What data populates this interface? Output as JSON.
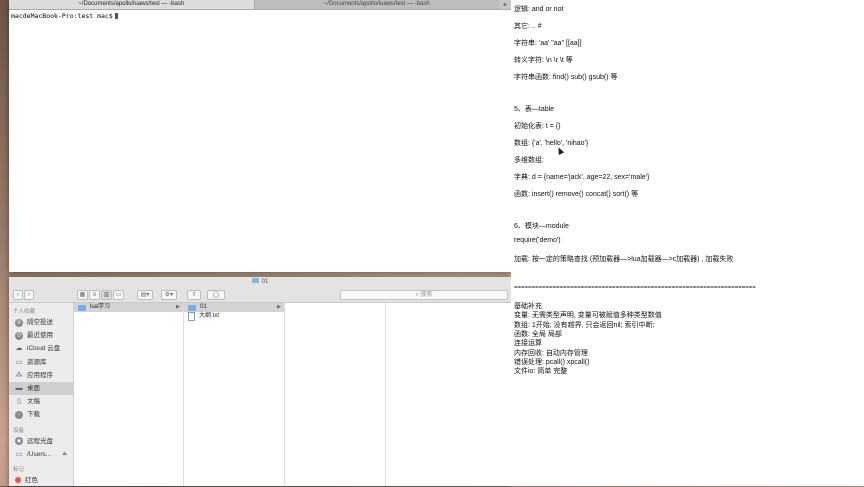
{
  "terminal": {
    "tabs": [
      {
        "label": "~/Documents/apollo/luaws/test — -bash",
        "active": true
      },
      {
        "label": "~/Documents/apollo/luaws/test — -bash",
        "active": false
      }
    ],
    "add_tab": "+",
    "prompt": "macdeMacBook-Pro:test mac$"
  },
  "finder": {
    "title": "01",
    "search_placeholder": "搜索",
    "sidebar": {
      "favorites_header": "个人收藏",
      "favorites": [
        {
          "label": "隔空投送",
          "icon": "airdrop-icon"
        },
        {
          "label": "最近使用",
          "icon": "clock-icon"
        },
        {
          "label": "iCloud 云盘",
          "icon": "cloud-icon"
        },
        {
          "label": "资源库",
          "icon": "folder-icon"
        },
        {
          "label": "应用程序",
          "icon": "apps-icon"
        },
        {
          "label": "桌面",
          "icon": "desktop-icon",
          "selected": true
        },
        {
          "label": "文稿",
          "icon": "document-icon"
        },
        {
          "label": "下载",
          "icon": "download-icon"
        }
      ],
      "devices_header": "设备",
      "devices": [
        {
          "label": "远程光盘",
          "icon": "disc-icon"
        },
        {
          "label": "/Users...",
          "icon": "disk-icon"
        }
      ],
      "tags_header": "标记",
      "tags": [
        {
          "label": "红色",
          "color": "#ff4b3e"
        }
      ]
    },
    "col1": [
      {
        "label": "lua学习",
        "selected": true
      }
    ],
    "col2": [
      {
        "label": "01",
        "selected": true,
        "kind": "folder"
      },
      {
        "label": "大纲.txt",
        "kind": "txt"
      }
    ]
  },
  "editor": {
    "lines": [
      "逻辑: and or not",
      "其它: .. #",
      "字符串: 'aa' \"aa\" [[aa]]",
      "转义字符: \\n \\r \\t 等",
      "字符串函数: find() sub() gsub() 等",
      "5、表—table",
      "初始化表: t = {}",
      "数组: {'a', 'hello', 'nihao'}",
      "多维数组:",
      "字典: d = {name='jack', age=22, sex='male'}",
      "函数: insert() remove() concat() sort() 等",
      "6、模块—module",
      "require('demo')",
      "加载: 按一定的策略查找 (预加载器—>lua加载器—>c加载器) , 加载失败",
      "=====================================================================",
      "基础补充",
      "变量: 无需类型声明, 变量可被赋值多种类型数值",
      "数组: 1开始; 没有越界, 只会返回nil; 索引中断;",
      "函数: 全局 局部",
      "连接运算",
      "内存回收: 自动内存管理",
      "错误处理: pcall() xpcall()",
      "文件io: 简单 完整"
    ]
  }
}
